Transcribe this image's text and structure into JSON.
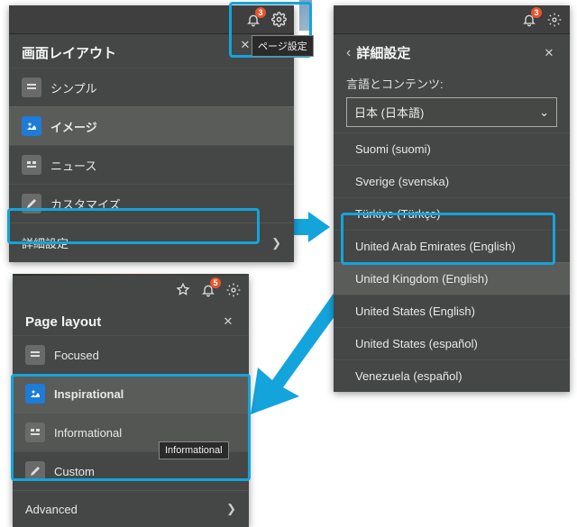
{
  "panel1": {
    "bell_badge": "3",
    "gear_tooltip": "ページ設定",
    "title": "画面レイアウト",
    "items": [
      {
        "label": "シンプル"
      },
      {
        "label": "イメージ"
      },
      {
        "label": "ニュース"
      },
      {
        "label": "カスタマイズ"
      }
    ],
    "advanced_label": "詳細設定"
  },
  "panel2": {
    "bell_badge": "3",
    "title": "詳細設定",
    "section_label": "言語とコンテンツ:",
    "selected": "日本 (日本語)",
    "options": [
      "Suomi (suomi)",
      "Sverige (svenska)",
      "Türkiye (Türkçe)",
      "United Arab Emirates (English)",
      "United Kingdom (English)",
      "United States (English)",
      "United States (español)",
      "Venezuela (español)"
    ]
  },
  "panel3": {
    "bell_badge": "5",
    "title": "Page layout",
    "items": [
      {
        "label": "Focused"
      },
      {
        "label": "Inspirational"
      },
      {
        "label": "Informational"
      },
      {
        "label": "Custom"
      }
    ],
    "tooltip": "Informational",
    "advanced_label": "Advanced"
  },
  "colors": {
    "highlight": "#14a4dc",
    "badge": "#e8552b"
  }
}
